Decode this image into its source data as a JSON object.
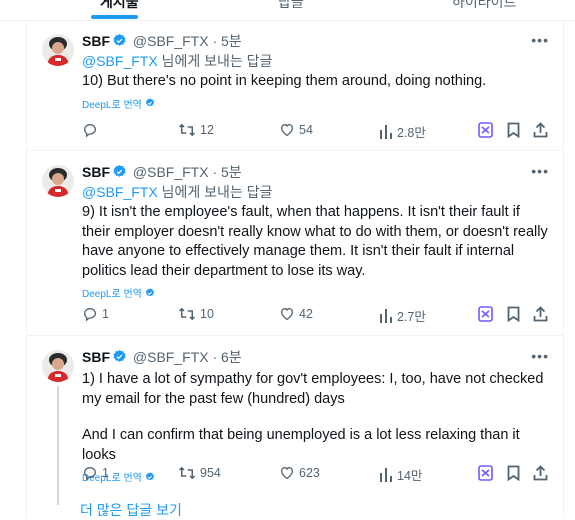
{
  "tabs": [
    "게시물",
    "답글",
    "하이라이트"
  ],
  "tweets": [
    {
      "name": "SBF",
      "handle": "@SBF_FTX",
      "dot": "·",
      "time": "5분",
      "reply_handle": "@SBF_FTX",
      "reply_suffix": " 님에게 보내는 답글",
      "text": "10) But there's no point in keeping them around, doing nothing.",
      "translate": "DeepL로 번역",
      "replies": "",
      "retweets": "12",
      "likes": "54",
      "views": "2.8만"
    },
    {
      "name": "SBF",
      "handle": "@SBF_FTX",
      "dot": "·",
      "time": "5분",
      "reply_handle": "@SBF_FTX",
      "reply_suffix": " 님에게 보내는 답글",
      "text": "9) It isn't the employee's fault, when that happens. It isn't their fault if their employer doesn't really know what to do with them, or doesn't really have anyone to effectively manage them. It isn't their fault if internal politics lead their department to lose its way.",
      "translate": "DeepL로 번역",
      "replies": "1",
      "retweets": "10",
      "likes": "42",
      "views": "2.7만"
    },
    {
      "name": "SBF",
      "handle": "@SBF_FTX",
      "dot": "·",
      "time": "6분",
      "text": "1) I have a lot of sympathy for gov't employees: I, too, have not checked my email for the past few (hundred) days",
      "text2": "And I can confirm that being unemployed is a lot less relaxing than it looks",
      "translate": "DeepL로 번역",
      "replies": "1",
      "retweets": "954",
      "likes": "623",
      "views": "14만"
    }
  ],
  "more_replies": "더 많은 답글 보기",
  "colors": {
    "accent": "#1d9bf0",
    "muted": "#536471",
    "grok": "#7856ff"
  }
}
